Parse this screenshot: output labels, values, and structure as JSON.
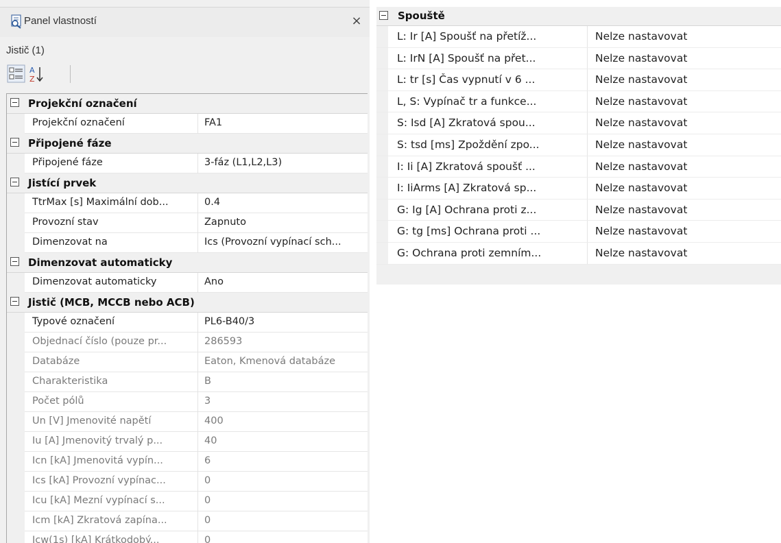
{
  "panel": {
    "title": "Panel vlastností",
    "close_glyph": "×",
    "selection": "Jistič (1)",
    "toolbar": {
      "categorized_icon": "categorized-view-icon",
      "alphabetical_icon": "sort-az-icon"
    }
  },
  "colors": {
    "panel_bg": "#f0f0f0",
    "grid_bg": "#ffffff",
    "readonly_text": "#7a7a7a"
  },
  "left_grid": [
    {
      "category": "Projekční označení",
      "rows": [
        {
          "name": "Projekční označení",
          "value": "FA1",
          "readonly": false
        }
      ]
    },
    {
      "category": "Připojené fáze",
      "rows": [
        {
          "name": "Připojené fáze",
          "value": "3-fáz (L1,L2,L3)",
          "readonly": false
        }
      ]
    },
    {
      "category": "Jistící prvek",
      "rows": [
        {
          "name": "TtrMax [s] Maximální dob...",
          "value": "0.4",
          "readonly": false
        },
        {
          "name": "Provozní stav",
          "value": "Zapnuto",
          "readonly": false
        },
        {
          "name": "Dimenzovat na",
          "value": "Ics (Provozní vypínací sch...",
          "readonly": false
        }
      ]
    },
    {
      "category": "Dimenzovat automaticky",
      "rows": [
        {
          "name": "Dimenzovat automaticky",
          "value": "Ano",
          "readonly": false
        }
      ]
    },
    {
      "category": "Jistič (MCB, MCCB nebo ACB)",
      "rows": [
        {
          "name": "Typové označení",
          "value": "PL6-B40/3",
          "readonly": false
        },
        {
          "name": "Objednací číslo (pouze pr...",
          "value": "286593",
          "readonly": true
        },
        {
          "name": "Databáze",
          "value": "Eaton, Kmenová databáze",
          "readonly": true
        },
        {
          "name": "Charakteristika",
          "value": "B",
          "readonly": true
        },
        {
          "name": "Počet pólů",
          "value": "3",
          "readonly": true
        },
        {
          "name": "Un [V] Jmenovité napětí",
          "value": "400",
          "readonly": true
        },
        {
          "name": "Iu [A] Jmenovitý trvalý p...",
          "value": "40",
          "readonly": true
        },
        {
          "name": "Icn [kA] Jmenovitá vypín...",
          "value": "6",
          "readonly": true
        },
        {
          "name": "Ics [kA] Provozní vypínac...",
          "value": "0",
          "readonly": true
        },
        {
          "name": "Icu [kA] Mezní vypínací s...",
          "value": "0",
          "readonly": true
        },
        {
          "name": "Icm [kA] Zkratová zapína...",
          "value": "0",
          "readonly": true
        },
        {
          "name": "Icw(1s) [kA] Krátkodobý...",
          "value": "0",
          "readonly": true
        }
      ]
    }
  ],
  "right_grid": {
    "category": "Spouště",
    "rows": [
      {
        "name": "L: Ir [A] Spoušť na přetíž...",
        "value": "Nelze nastavovat"
      },
      {
        "name": "L: IrN [A] Spoušť na přet...",
        "value": "Nelze nastavovat"
      },
      {
        "name": "L: tr [s] Čas vypnutí v 6 ...",
        "value": "Nelze nastavovat"
      },
      {
        "name": "L, S:  Vypínač tr a funkce...",
        "value": "Nelze nastavovat"
      },
      {
        "name": "S: Isd [A] Zkratová spou...",
        "value": "Nelze nastavovat"
      },
      {
        "name": "S: tsd [ms] Zpoždění zpo...",
        "value": "Nelze nastavovat"
      },
      {
        "name": "I: Ii [A] Zkratová spoušť ...",
        "value": "Nelze nastavovat"
      },
      {
        "name": "I: IiArms [A] Zkratová sp...",
        "value": "Nelze nastavovat"
      },
      {
        "name": "G: Ig [A] Ochrana proti z...",
        "value": "Nelze nastavovat"
      },
      {
        "name": "G: tg [ms] Ochrana proti ...",
        "value": "Nelze nastavovat"
      },
      {
        "name": "G:  Ochrana proti zemním...",
        "value": "Nelze nastavovat"
      }
    ]
  }
}
